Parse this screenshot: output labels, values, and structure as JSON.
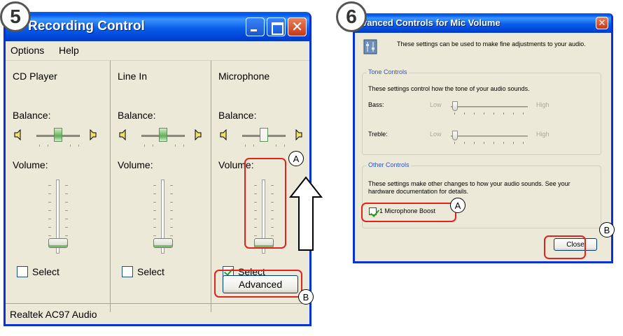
{
  "steps": {
    "left": "5",
    "right": "6"
  },
  "recording_control": {
    "title": "Recording Control",
    "menu": [
      "Options",
      "Help"
    ],
    "channels": [
      {
        "name": "CD Player",
        "balance_label": "Balance:",
        "volume_label": "Volume:",
        "select_label": "Select",
        "selected": false
      },
      {
        "name": "Line In",
        "balance_label": "Balance:",
        "volume_label": "Volume:",
        "select_label": "Select",
        "selected": false
      },
      {
        "name": "Microphone",
        "balance_label": "Balance:",
        "volume_label": "Volume:",
        "select_label": "Select",
        "selected": true
      }
    ],
    "advanced_button": "Advanced",
    "status": "Realtek AC97 Audio"
  },
  "advanced_controls": {
    "title": "vanced Controls for Mic Volume",
    "intro": "These settings can be used to make fine adjustments to your audio.",
    "tone": {
      "title": "Tone Controls",
      "description": "These settings control how the tone of your audio sounds.",
      "bass_label": "Bass:",
      "treble_label": "Treble:",
      "low_label": "Low",
      "high_label": "High"
    },
    "other": {
      "title": "Other Controls",
      "description": "These settings make other changes to how your audio sounds.  See your hardware documentation for details.",
      "boost_label": "1  Microphone Boost",
      "boost_checked": true
    },
    "close_button": "Close"
  },
  "markers": {
    "a": "A",
    "b": "B"
  },
  "colors": {
    "xp_blue": "#0058ee",
    "highlight_red": "#e0231b",
    "face": "#ece9d8"
  }
}
